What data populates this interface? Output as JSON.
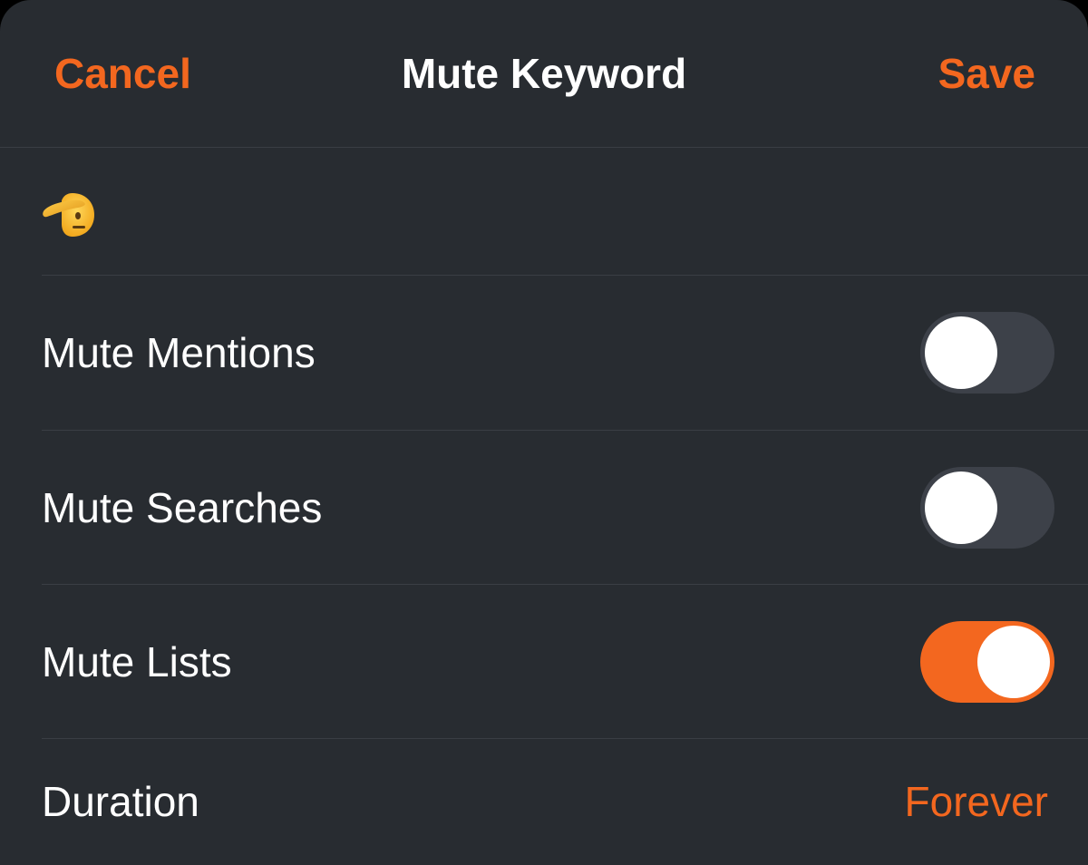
{
  "nav": {
    "cancel_label": "Cancel",
    "title": "Mute Keyword",
    "save_label": "Save"
  },
  "keyword": {
    "value": "🫡",
    "icon": "saluting-face-emoji"
  },
  "options": [
    {
      "label": "Mute Mentions",
      "enabled": false
    },
    {
      "label": "Mute Searches",
      "enabled": false
    },
    {
      "label": "Mute Lists",
      "enabled": true
    }
  ],
  "duration": {
    "label": "Duration",
    "value": "Forever"
  },
  "colors": {
    "accent": "#f3671f",
    "background": "#282c31",
    "separator": "#3a3e44",
    "toggle_off": "#3d4149"
  }
}
